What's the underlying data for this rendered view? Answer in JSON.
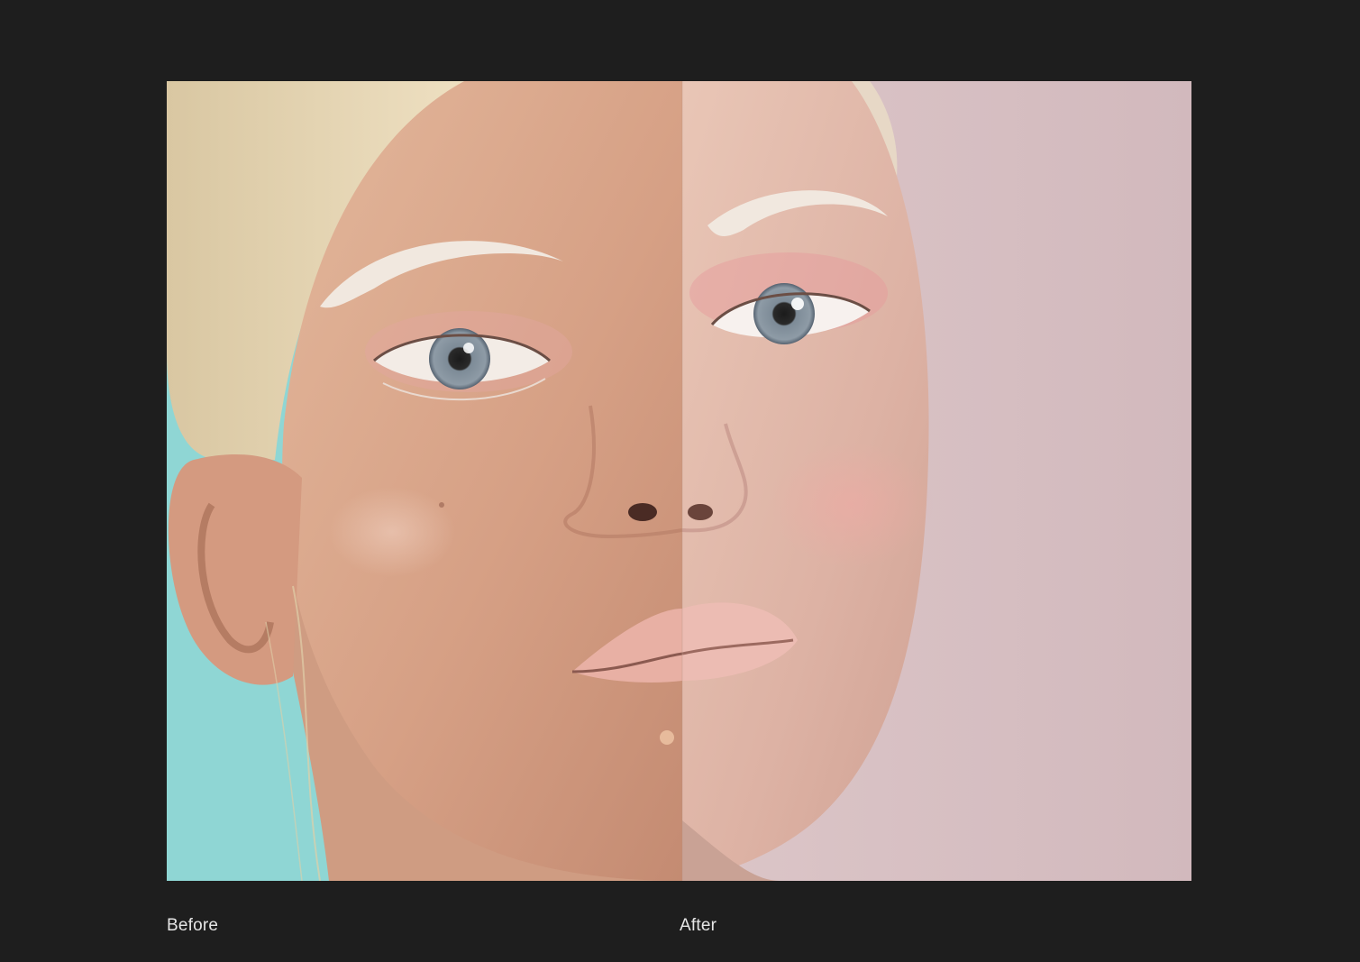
{
  "comparison": {
    "before_label": "Before",
    "after_label": "After"
  },
  "colors": {
    "page_background": "#1e1e1e",
    "before_background": "#8fd6d4",
    "after_background": "#d8c1c4",
    "skin_before": "#d9a48a",
    "skin_after": "#e2b8aa",
    "hair": "#e8d7b4",
    "brow": "#f1e8df",
    "iris": "#7d8b97",
    "lips": "#e6aaa0",
    "caption_text": "#e6e6e6"
  }
}
